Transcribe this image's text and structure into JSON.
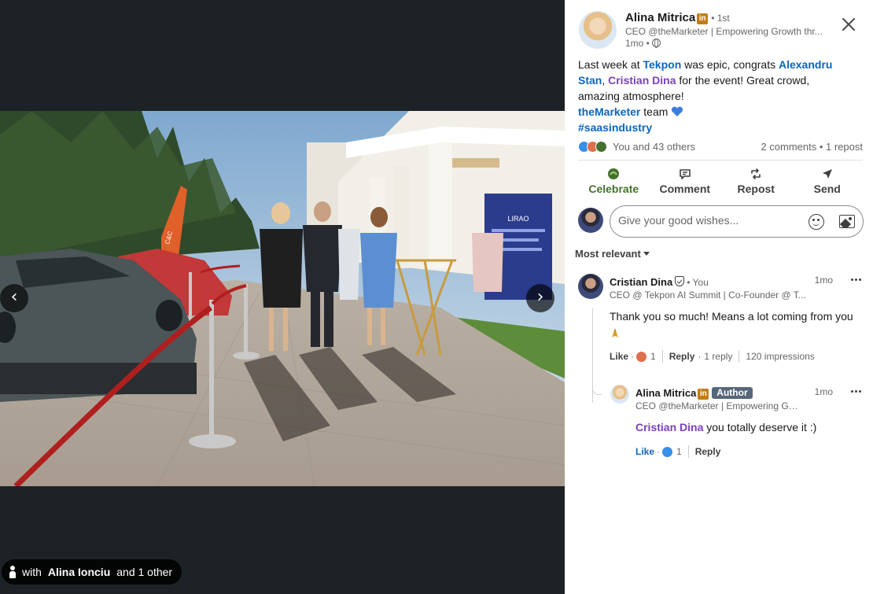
{
  "media": {
    "prev_label": "‹",
    "next_label": "›",
    "tag_prefix": "with",
    "tag_person": "Alina Ionciu",
    "tag_suffix": "and 1 other",
    "banner_text": "LIRAO",
    "flag_text": "C&C"
  },
  "post": {
    "author_name": "Alina Mitrica",
    "author_badge": "in",
    "degree": "• 1st",
    "author_headline": "CEO @theMarketer | Empowering Growth thr...",
    "time": "1mo •",
    "text_1": "Last week at ",
    "link_tekpon": "Tekpon",
    "text_2": " was epic, congrats ",
    "link_alexandru": "Alexandru Stan",
    "text_3": ", ",
    "link_cristian": "Cristian Dina",
    "text_4": " for the event! Great crowd, amazing atmosphere!",
    "link_themarketer": "theMarketer",
    "text_5": " team ",
    "hashtag": "#saasindustry",
    "reactions_text": "You and 43 others",
    "comments_text": "2 comments • 1 repost"
  },
  "actions": [
    {
      "label": "Celebrate",
      "icon": "celebrate-icon"
    },
    {
      "label": "Comment",
      "icon": "comment-icon"
    },
    {
      "label": "Repost",
      "icon": "repost-icon"
    },
    {
      "label": "Send",
      "icon": "send-icon"
    }
  ],
  "comment_box": {
    "placeholder": "Give your good wishes..."
  },
  "sort": {
    "label": "Most relevant"
  },
  "comments": [
    {
      "name": "Cristian Dina",
      "you_label": "• You",
      "headline": "CEO @ Tekpon AI Summit | Co-Founder @ T...",
      "time": "1mo",
      "text": "Thank you so much! Means a lot coming from you",
      "like_label": "Like",
      "like_count": "1",
      "reply_label": "Reply",
      "reply_count": "1 reply",
      "impressions": "120 impressions"
    },
    {
      "name": "Alina Mitrica",
      "badge": "in",
      "author_label": "Author",
      "headline": "CEO @theMarketer | Empowering Gro...",
      "time": "1mo",
      "mention": "Cristian Dina",
      "text": " you totally deserve it :)",
      "like_label": "Like",
      "like_count": "1",
      "reply_label": "Reply"
    }
  ],
  "colors": {
    "link": "#0a66c2",
    "mention": "#7a3fbf",
    "celebrate": "#44712e",
    "author_badge": "#56687a",
    "background_dark": "#1d2226"
  }
}
